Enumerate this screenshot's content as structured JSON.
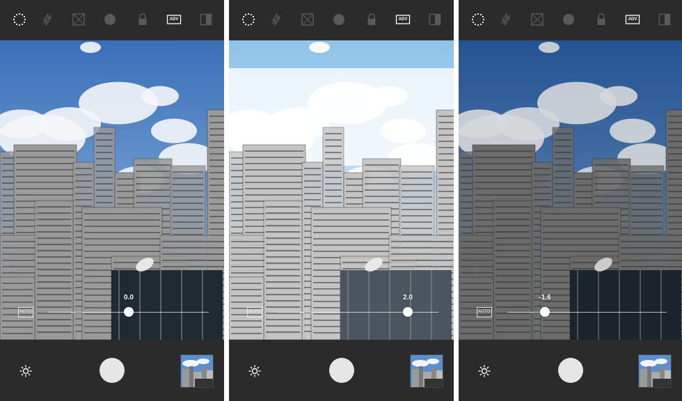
{
  "panels": [
    {
      "id": "before",
      "top_icons": [
        {
          "name": "timer-dotted-circle-icon",
          "active": true
        },
        {
          "name": "flash-off-icon",
          "active": false
        },
        {
          "name": "grid-icon",
          "active": false
        },
        {
          "name": "circle-icon",
          "active": false
        },
        {
          "name": "lock-icon",
          "active": false
        },
        {
          "name": "adv-icon",
          "label": "ADV",
          "active": true
        },
        {
          "name": "split-view-icon",
          "active": false
        }
      ],
      "exposure": {
        "auto_label": "AUTO",
        "value": "0.0",
        "level": 0.0
      },
      "bottom": {
        "sun_icon": "brightness-sun-icon",
        "shutter": "shutter-button",
        "thumbnail": "photo-thumbnail"
      },
      "scene": {
        "sky_top": "#3a6fb8",
        "sky_bottom": "#9cc0e4",
        "building_tone": "#9a9a9a",
        "overexposed": false
      }
    },
    {
      "id": "overexposed",
      "top_icons": [
        {
          "name": "timer-dotted-circle-icon",
          "active": true
        },
        {
          "name": "flash-off-icon",
          "active": false
        },
        {
          "name": "grid-icon",
          "active": false
        },
        {
          "name": "circle-icon",
          "active": false
        },
        {
          "name": "lock-icon",
          "active": false
        },
        {
          "name": "adv-icon",
          "label": "ADV",
          "active": true
        },
        {
          "name": "split-view-icon",
          "active": false
        }
      ],
      "exposure": {
        "auto_label": "AUTO",
        "value": "2.0",
        "level": 2.0
      },
      "bottom": {
        "sun_icon": "brightness-sun-icon",
        "shutter": "shutter-button",
        "thumbnail": "photo-thumbnail"
      },
      "scene": {
        "sky_top": "#8fc3ea",
        "sky_bottom": "#f2f7fb",
        "building_tone": "#c4c4c4",
        "overexposed": true
      }
    },
    {
      "id": "underexposed",
      "top_icons": [
        {
          "name": "timer-dotted-circle-icon",
          "active": true
        },
        {
          "name": "flash-off-icon",
          "active": false
        },
        {
          "name": "grid-icon",
          "active": false
        },
        {
          "name": "circle-icon",
          "active": false
        },
        {
          "name": "lock-icon",
          "active": false
        },
        {
          "name": "adv-icon",
          "label": "ADV",
          "active": true
        },
        {
          "name": "split-view-icon",
          "active": false
        }
      ],
      "exposure": {
        "auto_label": "AUTO",
        "value": "-1.6",
        "level": -1.6
      },
      "bottom": {
        "sun_icon": "brightness-sun-icon",
        "shutter": "shutter-button",
        "thumbnail": "photo-thumbnail"
      },
      "scene": {
        "sky_top": "#2a5fa8",
        "sky_bottom": "#7ea6d2",
        "building_tone": "#7a7a7a",
        "overexposed": false
      }
    }
  ],
  "colors": {
    "bar_background": "#2b2b2b",
    "icon_active": "#ffffff",
    "icon_inactive": "#5a5a5a",
    "shutter": "#e6e6e6"
  },
  "exposure_range": [
    -3,
    3
  ]
}
